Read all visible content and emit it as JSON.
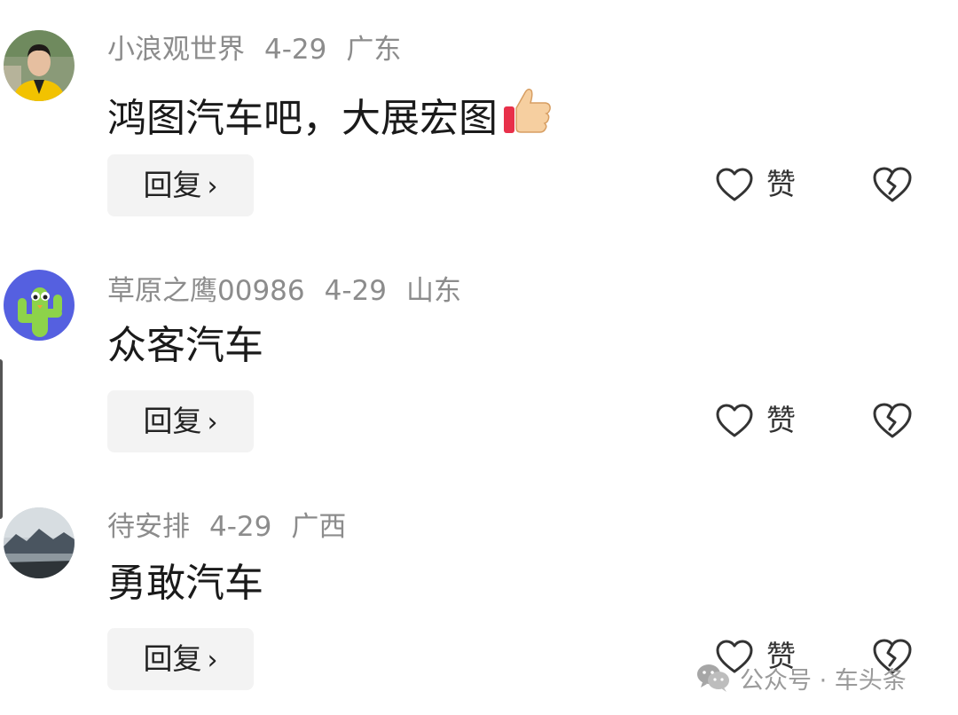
{
  "comments": [
    {
      "username": "小浪观世界",
      "date": "4-29",
      "location": "广东",
      "text": "鸿图汽车吧，大展宏图",
      "emoji": "thumbs-up",
      "reply_label": "回复",
      "like_label": "赞",
      "avatar": "man-in-yellow-jacket"
    },
    {
      "username": "草原之鹰00986",
      "date": "4-29",
      "location": "山东",
      "text": "众客汽车",
      "reply_label": "回复",
      "like_label": "赞",
      "avatar": "green-cactus-cartoon"
    },
    {
      "username": "待安排",
      "date": "4-29",
      "location": "广西",
      "text": "勇敢汽车",
      "reply_label": "回复",
      "like_label": "赞",
      "avatar": "mountain-lake-landscape"
    }
  ],
  "watermark": {
    "text": "公众号 · 车头条",
    "icon": "wechat-icon"
  },
  "icons": {
    "like": "heart-outline-icon",
    "dislike": "broken-heart-icon",
    "reply_chevron": "chevron-right-icon"
  },
  "colors": {
    "meta_text": "#8c8c8c",
    "reply_bg": "#f3f3f3",
    "icon_stroke": "#333333"
  }
}
